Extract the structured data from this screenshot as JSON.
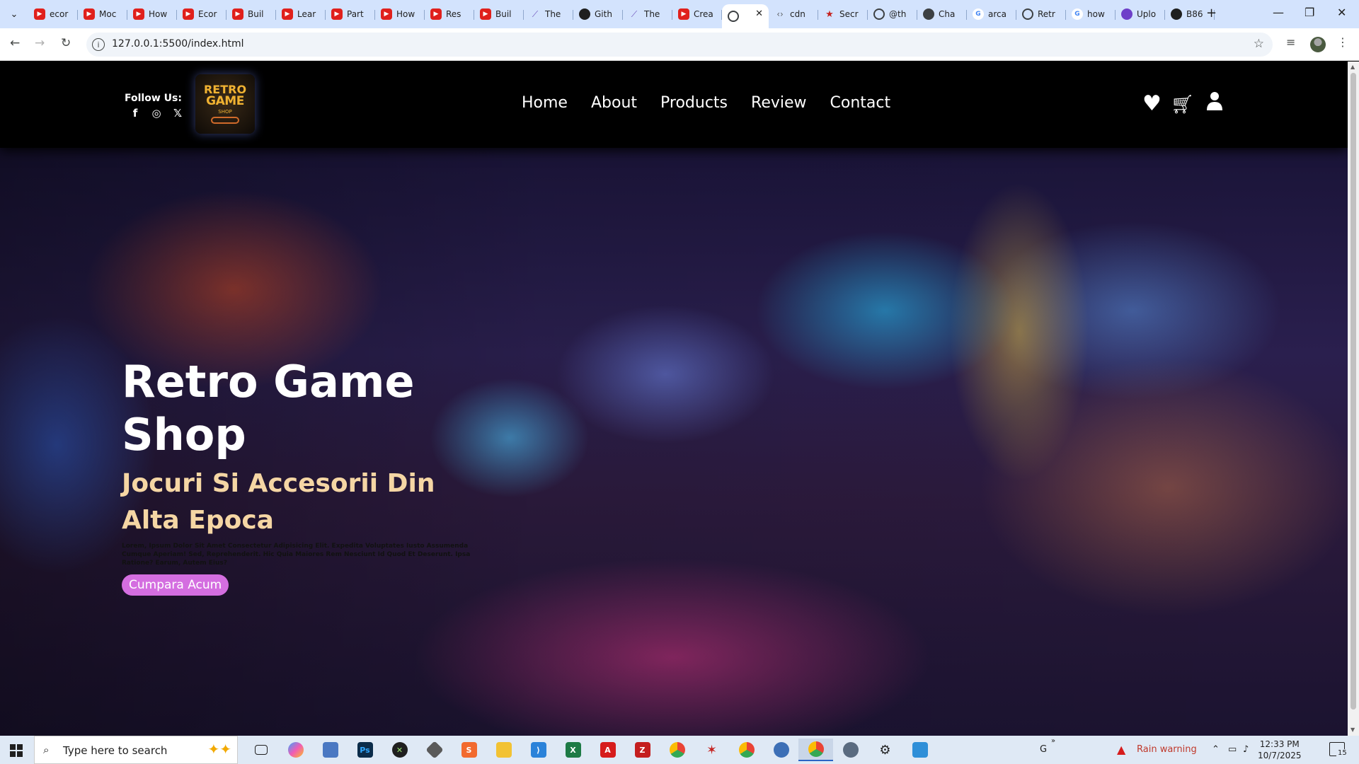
{
  "browser": {
    "tabs": [
      {
        "title": "ecor",
        "icon": "youtube"
      },
      {
        "title": "Moc",
        "icon": "youtube"
      },
      {
        "title": "How",
        "icon": "youtube"
      },
      {
        "title": "Ecor",
        "icon": "youtube"
      },
      {
        "title": "Buil",
        "icon": "youtube"
      },
      {
        "title": "Lear",
        "icon": "youtube"
      },
      {
        "title": "Part",
        "icon": "youtube"
      },
      {
        "title": "How",
        "icon": "youtube"
      },
      {
        "title": "Res",
        "icon": "youtube"
      },
      {
        "title": "Buil",
        "icon": "youtube"
      },
      {
        "title": "The",
        "icon": "triangle"
      },
      {
        "title": "Gith",
        "icon": "github"
      },
      {
        "title": "The",
        "icon": "triangle"
      },
      {
        "title": "Crea",
        "icon": "youtube"
      },
      {
        "title": "",
        "icon": "globe",
        "active": true
      },
      {
        "title": "cdn",
        "icon": "code"
      },
      {
        "title": "Secr",
        "icon": "star"
      },
      {
        "title": "@th",
        "icon": "globe"
      },
      {
        "title": "Cha",
        "icon": "chatgpt"
      },
      {
        "title": "arca",
        "icon": "google"
      },
      {
        "title": "Retr",
        "icon": "globe"
      },
      {
        "title": "how",
        "icon": "google"
      },
      {
        "title": "Uplo",
        "icon": "upload"
      },
      {
        "title": "B86",
        "icon": "github"
      }
    ],
    "url": "127.0.0.1:5500/index.html"
  },
  "site": {
    "follow_label": "Follow Us:",
    "socials": [
      "f",
      "◎",
      "𝕏"
    ],
    "logo": {
      "line1": "RETRO",
      "line2": "GAME",
      "line3": "SHOP"
    },
    "nav": [
      "Home",
      "About",
      "Products",
      "Review",
      "Contact"
    ],
    "hero": {
      "title": "Retro Game Shop",
      "subtitle": "Jocuri Si Accesorii Din Alta Epoca",
      "description": "Lorem, Ipsum Dolor Sit Amet Consectetur Adipisicing Elit. Expedita Voluptates Iusto Assumenda Cumque Aperiam! Sed, Reprehenderit. Hic Quia Maiores Rem Nesciunt Id Quod Et Deserunt. Ipsa Ratione? Earum, Autem Eius?",
      "button": "Cumpara Acum"
    },
    "colors": {
      "accent_button": "#d46ee0",
      "subtitle": "#f5d6a4"
    }
  },
  "taskbar": {
    "search_placeholder": "Type here to search",
    "weather": "Rain warning",
    "time": "12:33 PM",
    "date": "10/7/2025",
    "lang": "G",
    "notifications": "15"
  }
}
